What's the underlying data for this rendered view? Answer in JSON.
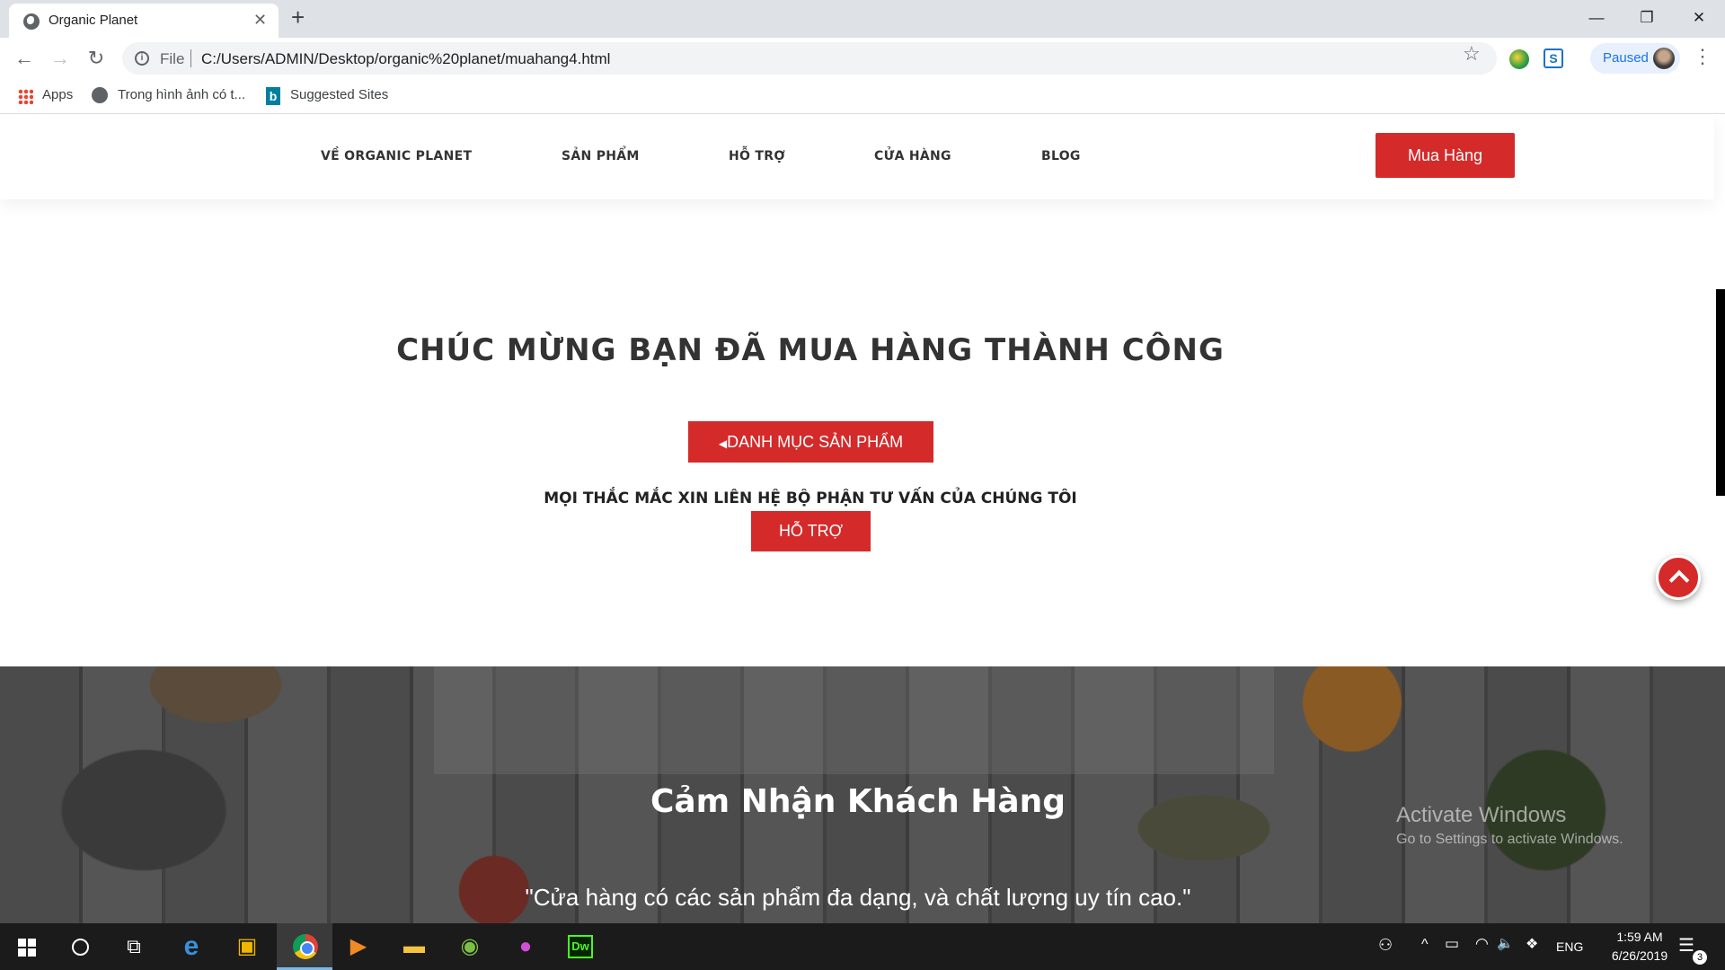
{
  "browser": {
    "tab_title": "Organic Planet",
    "tab_close": "✕",
    "new_tab": "+",
    "window_controls": {
      "minimize": "—",
      "maximize": "❐",
      "close": "✕"
    },
    "nav": {
      "back": "←",
      "forward": "→",
      "reload": "↻"
    },
    "info_glyph": "i",
    "omnibox_label": "File",
    "url": "C:/Users/ADMIN/Desktop/organic%20planet/muahang4.html",
    "star": "☆",
    "ext_glyph": "S",
    "profile_label": "Paused",
    "menu": "⋮",
    "bookmarks": [
      "Apps",
      "Trong hình ảnh có t...",
      "Suggested Sites"
    ],
    "bing_glyph": "b"
  },
  "site": {
    "nav": [
      "VỀ ORGANIC PLANET",
      "SẢN PHẨM",
      "HỖ TRỢ",
      "CỬA HÀNG",
      "BLOG"
    ],
    "buy_button": "Mua Hàng",
    "success_title": "CHÚC MỪNG BẠN ĐÃ MUA HÀNG THÀNH CÔNG",
    "catalog_caret": "◀",
    "catalog_button": "DANH MỤC SẢN PHẨM",
    "support_note": "MỌI THẮC MẮC XIN LIÊN HỆ BỘ PHẬN TƯ VẤN CỦA CHÚNG TÔI",
    "support_button": "HỖ TRỢ",
    "testimonial_title": "Cảm Nhận Khách Hàng",
    "testimonial_quote": "\"Cửa hàng có các sản phẩm đa dạng, và chất lượng uy tín cao.\"",
    "accent_color": "#d42a2a"
  },
  "os": {
    "watermark_title": "Activate Windows",
    "watermark_sub": "Go to Settings to activate Windows.",
    "taskbar_glyphs": {
      "task_view": "⧉",
      "edge": "e",
      "store": "▣",
      "media": "▶",
      "explorer": "▬",
      "app_green": "◉",
      "app_balloon": "●",
      "dw": "Dw"
    },
    "tray": {
      "people": "⚇",
      "chevron": "^",
      "battery": "▭",
      "wifi": "◠",
      "volume": "🔈",
      "dropbox": "❖",
      "lang": "ENG",
      "notif_glyph": "☰"
    },
    "time": "1:59 AM",
    "date": "6/26/2019",
    "notification_count": "3"
  }
}
